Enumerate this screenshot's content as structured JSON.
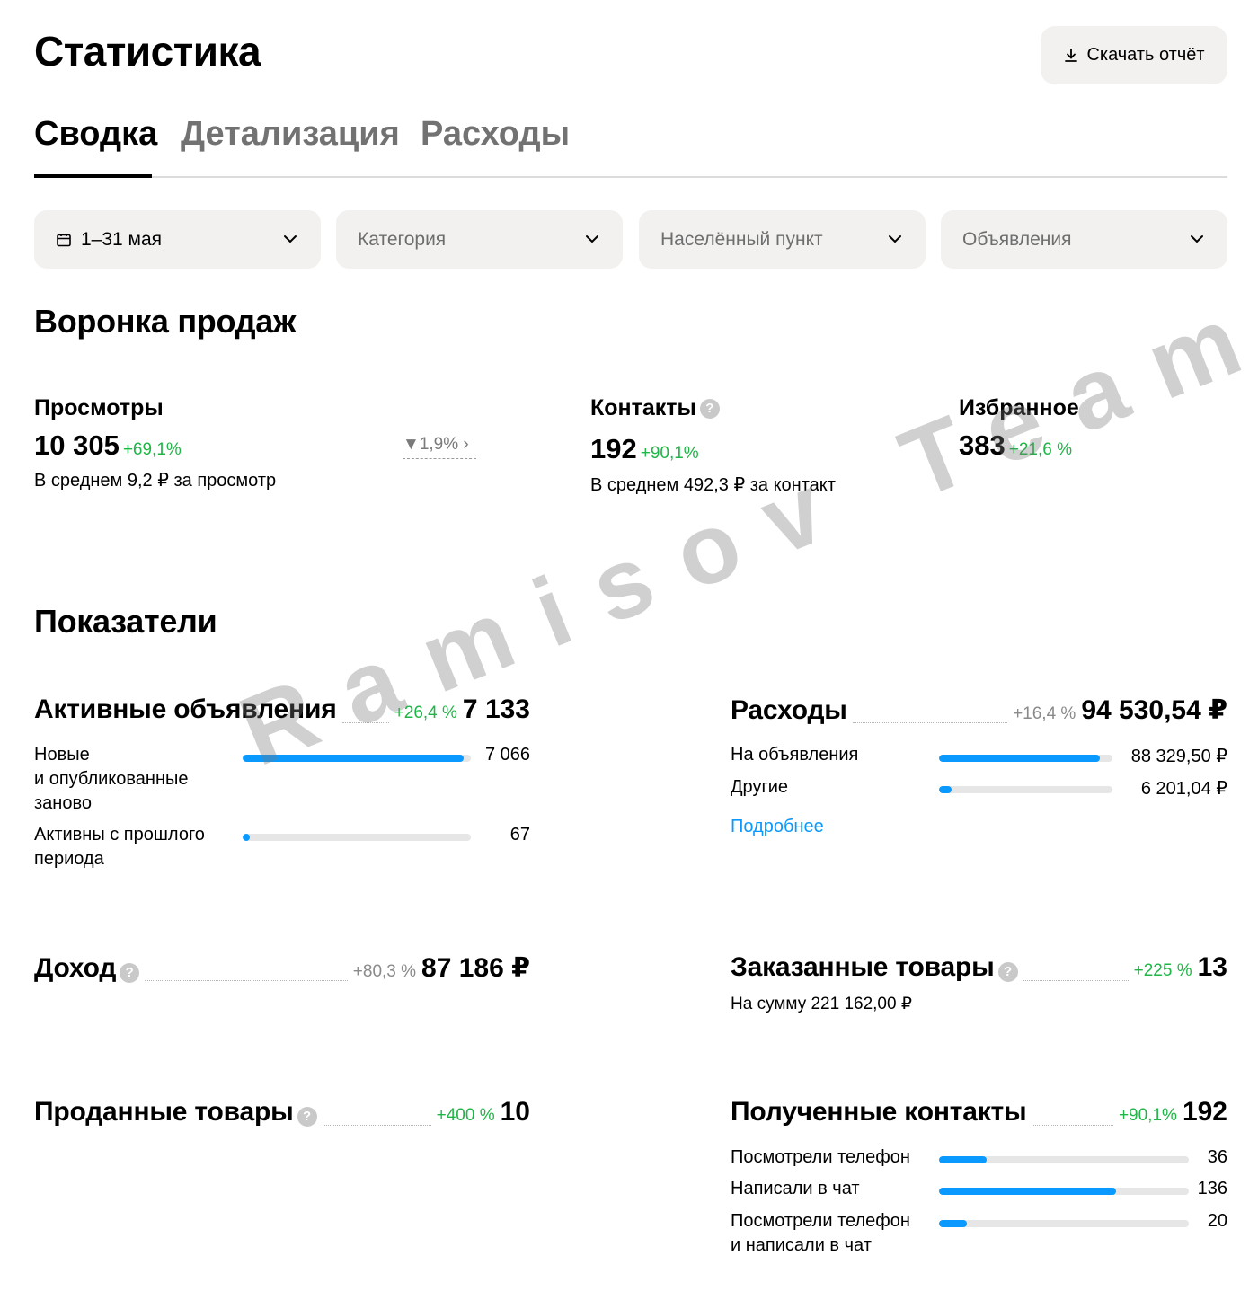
{
  "header": {
    "title": "Статистика",
    "download_label": "Скачать отчёт"
  },
  "tabs": [
    {
      "label": "Сводка",
      "active": true
    },
    {
      "label": "Детализация",
      "active": false
    },
    {
      "label": "Расходы",
      "active": false
    }
  ],
  "filters": {
    "date": "1–31 мая",
    "category": "Категория",
    "locality": "Населённый пункт",
    "ads": "Объявления"
  },
  "funnel": {
    "title": "Воронка продаж",
    "views": {
      "label": "Просмотры",
      "value": "10 305",
      "delta": "+69,1%",
      "sub": "В среднем 9,2 ₽ за просмотр",
      "conversion": "1,9%"
    },
    "contacts": {
      "label": "Контакты",
      "value": "192",
      "delta": "+90,1%",
      "sub": "В среднем 492,3 ₽ за контакт"
    },
    "favorites": {
      "label": "Избранное",
      "value": "383",
      "delta": "+21,6 %"
    }
  },
  "metrics": {
    "title": "Показатели",
    "active_ads": {
      "name": "Активные объявления",
      "delta": "+26,4 %",
      "value": "7 133",
      "rows": [
        {
          "label_1": "Новые",
          "label_2": "и опубликованные",
          "label_3": "заново",
          "value": "7 066",
          "fill": 0.97
        },
        {
          "label_1": "Активны с прошлого",
          "label_2": "периода",
          "value": "67",
          "fill": 0.03
        }
      ]
    },
    "expenses": {
      "name": "Расходы",
      "delta": "+16,4 %",
      "value": "94 530,54 ₽",
      "rows": [
        {
          "label": "На объявления",
          "value": "88 329,50 ₽",
          "fill": 0.93
        },
        {
          "label": "Другие",
          "value": "6 201,04 ₽",
          "fill": 0.07
        }
      ],
      "more_link": "Подробнее"
    },
    "income": {
      "name": "Доход",
      "delta": "+80,3 %",
      "value": "87 186 ₽"
    },
    "ordered": {
      "name": "Заказанные товары",
      "delta": "+225 %",
      "value": "13",
      "sub": "На сумму 221 162,00 ₽"
    },
    "sold": {
      "name": "Проданные товары",
      "delta": "+400 %",
      "value": "10"
    },
    "received_contacts": {
      "name": "Полученные контакты",
      "delta": "+90,1%",
      "value": "192",
      "rows": [
        {
          "label_1": "Посмотрели телефон",
          "value": "36",
          "fill": 0.19
        },
        {
          "label_1": "Написали в чат",
          "value": "136",
          "fill": 0.71
        },
        {
          "label_1": "Посмотрели телефон",
          "label_2": "и написали в чат",
          "value": "20",
          "fill": 0.11
        }
      ]
    }
  },
  "watermark": "Ramisov Team",
  "colors": {
    "accent": "#0a99ff",
    "positive": "#1fb547",
    "neutral_delta": "#8a8a8a",
    "chip_bg": "#f2f1f0"
  }
}
